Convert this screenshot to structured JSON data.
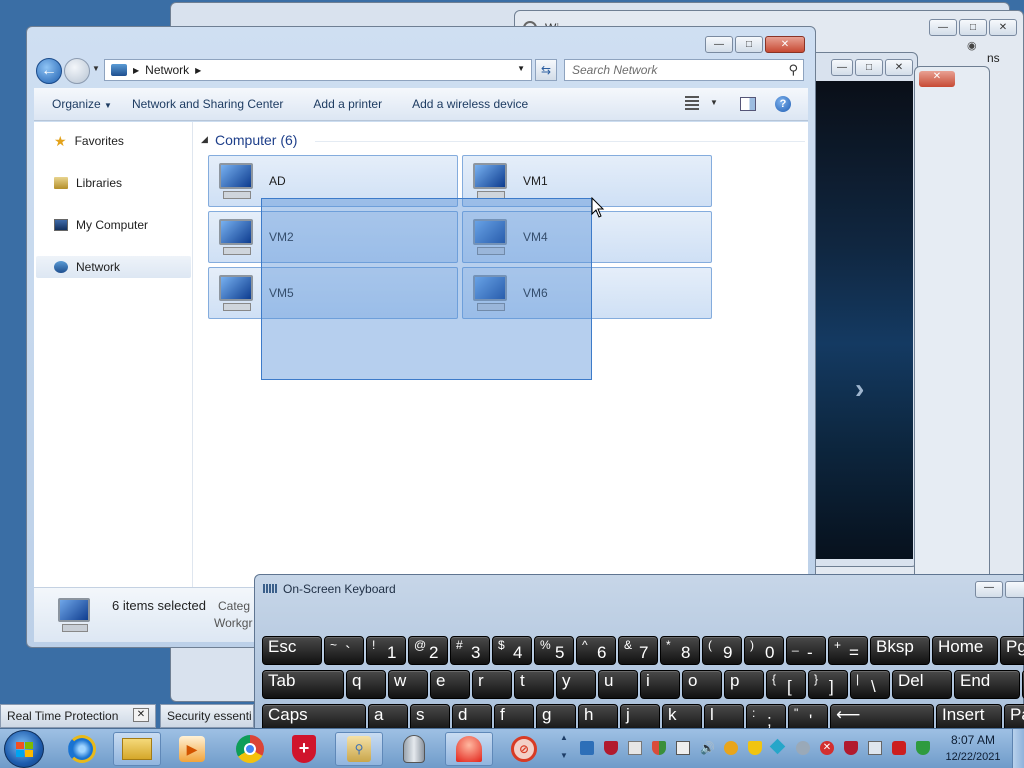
{
  "explorer": {
    "address": {
      "segment": "Network"
    },
    "search_placeholder": "Search Network",
    "commands": [
      "Organize",
      "Network and Sharing Center",
      "Add a printer",
      "Add a wireless device"
    ],
    "nav": [
      "Favorites",
      "Libraries",
      "My Computer",
      "Network"
    ],
    "group_header": "Computer (6)",
    "computers": [
      "AD",
      "VM1",
      "VM2",
      "VM4",
      "VM5",
      "VM6"
    ],
    "status": {
      "selected": "6 items selected",
      "category_label": "Categ",
      "workgroup_label": "Workgr"
    }
  },
  "background_window": {
    "partial_text": "Wi",
    "right_edge_text": "ns"
  },
  "osk": {
    "title": "On-Screen Keyboard",
    "row1": [
      {
        "label": "Esc"
      },
      {
        "top": "~",
        "bottom": "`"
      },
      {
        "top": "!",
        "bottom": "1"
      },
      {
        "top": "@",
        "bottom": "2"
      },
      {
        "top": "#",
        "bottom": "3"
      },
      {
        "top": "$",
        "bottom": "4"
      },
      {
        "top": "%",
        "bottom": "5"
      },
      {
        "top": "^",
        "bottom": "6"
      },
      {
        "top": "&",
        "bottom": "7"
      },
      {
        "top": "*",
        "bottom": "8"
      },
      {
        "top": "(",
        "bottom": "9"
      },
      {
        "top": ")",
        "bottom": "0"
      },
      {
        "top": "_",
        "bottom": "-"
      },
      {
        "top": "+",
        "bottom": "="
      },
      {
        "label": "Bksp"
      },
      {
        "label": "Home"
      },
      {
        "label": "Pg"
      }
    ],
    "row2": [
      {
        "label": "Tab"
      },
      {
        "label": "q"
      },
      {
        "label": "w"
      },
      {
        "label": "e"
      },
      {
        "label": "r"
      },
      {
        "label": "t"
      },
      {
        "label": "y"
      },
      {
        "label": "u"
      },
      {
        "label": "i"
      },
      {
        "label": "o"
      },
      {
        "label": "p"
      },
      {
        "top": "{",
        "bottom": "["
      },
      {
        "top": "}",
        "bottom": "]"
      },
      {
        "top": "|",
        "bottom": "\\"
      },
      {
        "label": "Del"
      },
      {
        "label": "End"
      },
      {
        "label": "Pg"
      }
    ],
    "row3": [
      {
        "label": "Caps"
      },
      {
        "label": "a"
      },
      {
        "label": "s"
      },
      {
        "label": "d"
      },
      {
        "label": "f"
      },
      {
        "label": "g"
      },
      {
        "label": "h"
      },
      {
        "label": "j"
      },
      {
        "label": "k"
      },
      {
        "label": "l"
      },
      {
        "top": ":",
        "bottom": ";"
      },
      {
        "top": "\"",
        "bottom": "'"
      },
      {
        "label": "⟵"
      },
      {
        "label": "Insert"
      },
      {
        "label": "Pa"
      }
    ]
  },
  "taskbar": {
    "tabs": [
      "Real Time Protection",
      "Security essenti"
    ],
    "clock": {
      "time": "8:07 AM",
      "date": "12/22/2021"
    }
  }
}
